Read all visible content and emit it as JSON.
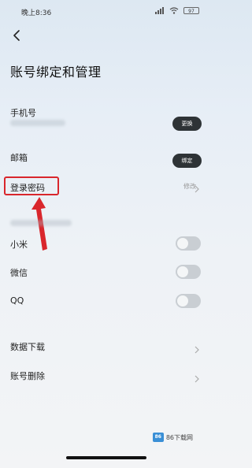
{
  "status_bar": {
    "time": "晚上8:36",
    "battery": "97"
  },
  "header": {
    "title": "账号绑定和管理"
  },
  "rows": {
    "phone": {
      "label": "手机号",
      "button": "更换"
    },
    "email": {
      "label": "邮箱",
      "button": "绑定"
    },
    "password": {
      "label": "登录密码",
      "value": "修改"
    }
  },
  "third_party": {
    "items": [
      {
        "label": "小米",
        "enabled": false
      },
      {
        "label": "微信",
        "enabled": false
      },
      {
        "label": "QQ",
        "enabled": false
      }
    ]
  },
  "bottom_rows": {
    "data_download": "数据下载",
    "delete_account": "账号删除"
  },
  "watermark": {
    "logo": "86",
    "text": "86下载网"
  },
  "colors": {
    "highlight": "#d9262c",
    "pill": "#2e3336",
    "toggle_off": "#c9ced3"
  }
}
